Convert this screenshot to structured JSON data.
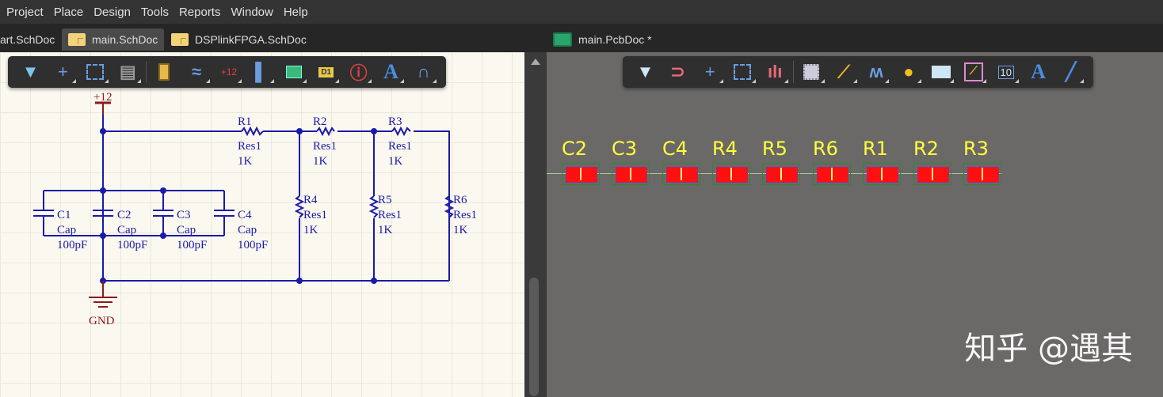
{
  "menu": [
    "Project",
    "Place",
    "Design",
    "Tools",
    "Reports",
    "Window",
    "Help"
  ],
  "tabs": {
    "left": [
      "art.SchDoc",
      "main.SchDoc",
      "DSPlinkFPGA.SchDoc"
    ],
    "right": "main.PcbDoc *"
  },
  "sch_toolbar": [
    "filter-icon",
    "crosshair-icon",
    "select-rect-icon",
    "align-icon",
    "part-icon",
    "bus-icon",
    "power-port-icon",
    "harness-icon",
    "sheet-symbol-icon",
    "net-label-icon",
    "directive-icon",
    "text-icon",
    "arc-icon"
  ],
  "sch_toolbar_text": {
    "power": "+12",
    "netlabel": "D1",
    "text": "A"
  },
  "pcb_toolbar": [
    "filter-icon",
    "snap-icon",
    "crosshair-icon",
    "select-rect-icon",
    "align-icon",
    "component-icon",
    "route-icon",
    "tune-icon",
    "via-icon",
    "polygon-icon",
    "track-icon",
    "dimension-icon",
    "text-icon",
    "line-icon"
  ],
  "pcb_toolbar_text": {
    "dimension": "10",
    "text": "A"
  },
  "schematic": {
    "power": "+12",
    "ground": "GND",
    "resistors": [
      {
        "ref": "R1",
        "type": "Res1",
        "value": "1K"
      },
      {
        "ref": "R2",
        "type": "Res1",
        "value": "1K"
      },
      {
        "ref": "R3",
        "type": "Res1",
        "value": "1K"
      },
      {
        "ref": "R4",
        "type": "Res1",
        "value": "1K"
      },
      {
        "ref": "R5",
        "type": "Res1",
        "value": "1K"
      },
      {
        "ref": "R6",
        "type": "Res1",
        "value": "1K"
      }
    ],
    "capacitors": [
      {
        "ref": "C1",
        "type": "Cap",
        "value": "100pF"
      },
      {
        "ref": "C2",
        "type": "Cap",
        "value": "100pF"
      },
      {
        "ref": "C3",
        "type": "Cap",
        "value": "100pF"
      },
      {
        "ref": "C4",
        "type": "Cap",
        "value": "100pF"
      }
    ]
  },
  "pcb": {
    "components": [
      "C2",
      "C3",
      "C4",
      "R4",
      "R5",
      "R6",
      "R1",
      "R2",
      "R3"
    ]
  },
  "watermark": "知乎 @遇其"
}
